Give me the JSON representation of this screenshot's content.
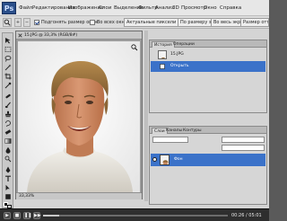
{
  "app": {
    "logo": "Ps"
  },
  "menubar": {
    "items": [
      "Файл",
      "Редактирование",
      "Изображение",
      "Слои",
      "Выделение",
      "Фильтр",
      "Анализ",
      "3D",
      "Просмотр",
      "Окно",
      "Справка"
    ],
    "zoom": "33,3"
  },
  "optionsbar": {
    "resize_windows_label": "Подгонять размер окон",
    "all_windows_label": "Во всех окнах",
    "actual_pixels_label": "Актуальные пиксели",
    "fit_screen_label": "По размеру экрана",
    "fill_screen_label": "Во весь экран",
    "print_size_label": "Размер оттиска"
  },
  "document": {
    "title": "15.JPG @ 33,3% (RGB/8#)",
    "zoom": "33,33%"
  },
  "history_panel": {
    "tabs": [
      "История",
      "Операции"
    ],
    "items": [
      {
        "label": "15.JPG"
      },
      {
        "label": "Открыть"
      }
    ]
  },
  "layers_panel": {
    "tabs": [
      "Слои",
      "Каналы",
      "Контуры"
    ],
    "layers": [
      {
        "label": "Фон"
      }
    ]
  },
  "player": {
    "time": "00:26 / 05:01",
    "progress": 0.086
  },
  "colors": {
    "selection": "#3b72c9",
    "workspace": "#d4d4d4"
  }
}
